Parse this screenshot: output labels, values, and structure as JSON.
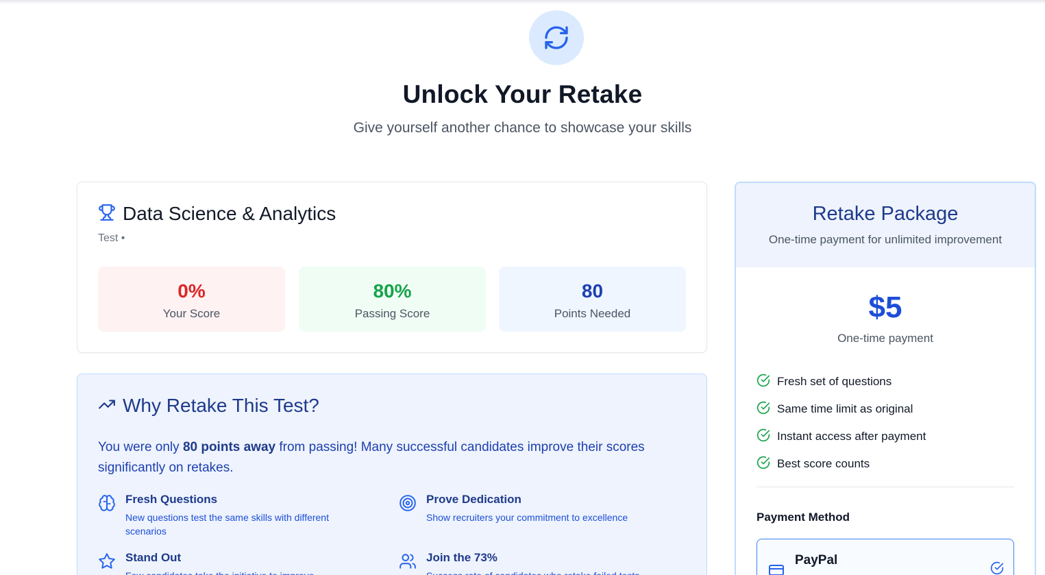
{
  "hero": {
    "icon": "refresh-icon",
    "title": "Unlock Your Retake",
    "subtitle": "Give yourself another chance to showcase your skills"
  },
  "test": {
    "icon": "trophy-icon",
    "name": "Data Science & Analytics",
    "meta": "Test •",
    "stats": [
      {
        "value": "0%",
        "label": "Your Score"
      },
      {
        "value": "80%",
        "label": "Passing Score"
      },
      {
        "value": "80",
        "label": "Points Needed"
      }
    ]
  },
  "why": {
    "icon": "trending-up-icon",
    "title": "Why Retake This Test?",
    "text_before": "You were only ",
    "text_bold": "80 points away",
    "text_after": " from passing! Many successful candidates improve their scores significantly on retakes.",
    "features": [
      {
        "icon": "brain-icon",
        "title": "Fresh Questions",
        "desc": "New questions test the same skills with different scenarios"
      },
      {
        "icon": "target-icon",
        "title": "Prove Dedication",
        "desc": "Show recruiters your commitment to excellence"
      },
      {
        "icon": "star-icon",
        "title": "Stand Out",
        "desc": "Few candidates take the initiative to improve"
      },
      {
        "icon": "users-icon",
        "title": "Join the 73%",
        "desc": "Success rate of candidates who retake failed tests"
      }
    ]
  },
  "package": {
    "title": "Retake Package",
    "subtitle": "One-time payment for unlimited improvement",
    "price": "$5",
    "price_note": "One-time payment",
    "benefits": [
      "Fresh set of questions",
      "Same time limit as original",
      "Instant access after payment",
      "Best score counts"
    ],
    "payment_label": "Payment Method",
    "payment_option": {
      "icon": "credit-card-icon",
      "name": "PayPal",
      "selected_icon": "check-circle-icon"
    }
  },
  "colors": {
    "accent": "#2563eb",
    "red": "#dc2626",
    "green": "#16a34a",
    "navy": "#1e3a8a"
  }
}
